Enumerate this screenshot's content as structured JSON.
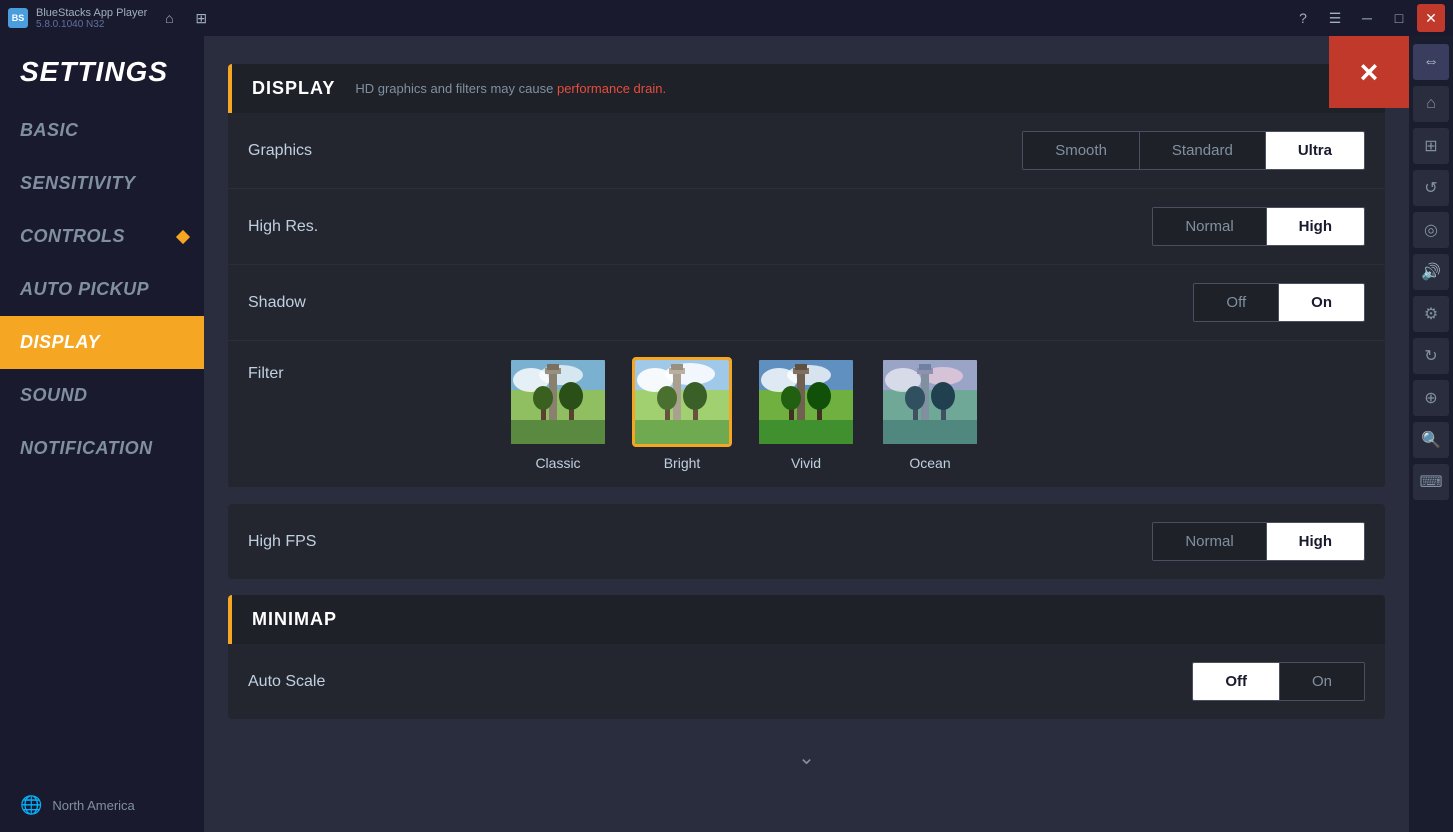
{
  "titleBar": {
    "appName": "BlueStacks App Player",
    "version": "5.8.0.1040  N32",
    "logoText": "BS",
    "navButtons": [
      "home",
      "layers"
    ],
    "windowButtons": [
      "help",
      "menu",
      "minimize",
      "maximize",
      "close"
    ]
  },
  "sidebar": {
    "title": "SETTINGS",
    "navItems": [
      {
        "id": "basic",
        "label": "BASIC",
        "active": false
      },
      {
        "id": "sensitivity",
        "label": "SENSITIVITY",
        "active": false
      },
      {
        "id": "controls",
        "label": "CONTROLS",
        "active": false,
        "hasDiamond": true
      },
      {
        "id": "auto-pickup",
        "label": "AUTO PICKUP",
        "active": false
      },
      {
        "id": "display",
        "label": "DISPLAY",
        "active": true
      },
      {
        "id": "sound",
        "label": "SOUND",
        "active": false
      },
      {
        "id": "notification",
        "label": "NOTIFICATION",
        "active": false
      }
    ],
    "bottomRegion": {
      "label": "North America"
    }
  },
  "content": {
    "closeButton": "×",
    "displaySection": {
      "title": "DISPLAY",
      "subtitle": "HD graphics and filters may cause",
      "subtitleHighlight": "performance drain.",
      "settings": {
        "graphics": {
          "label": "Graphics",
          "options": [
            "Smooth",
            "Standard",
            "Ultra"
          ],
          "selected": "Ultra"
        },
        "highRes": {
          "label": "High Res.",
          "options": [
            "Normal",
            "High"
          ],
          "selected": "High"
        },
        "shadow": {
          "label": "Shadow",
          "options": [
            "Off",
            "On"
          ],
          "selected": "On"
        },
        "filter": {
          "label": "Filter",
          "options": [
            {
              "name": "Classic",
              "selected": false
            },
            {
              "name": "Bright",
              "selected": true
            },
            {
              "name": "Vivid",
              "selected": false
            },
            {
              "name": "Ocean",
              "selected": false
            }
          ]
        }
      }
    },
    "highFpsSection": {
      "label": "High FPS",
      "options": [
        "Normal",
        "High"
      ],
      "selected": "High"
    },
    "minimapSection": {
      "title": "MINIMAP",
      "settings": {
        "autoScale": {
          "label": "Auto Scale",
          "options": [
            "Off",
            "On"
          ],
          "selected": "Off"
        }
      }
    },
    "scrollIndicator": "⌄"
  },
  "rightPanel": {
    "buttons": [
      "↕",
      "⊞",
      "↺",
      "◎",
      "⊡",
      "◫",
      "⊙",
      "⊛",
      "⊕",
      "⊜",
      "⊝"
    ]
  }
}
